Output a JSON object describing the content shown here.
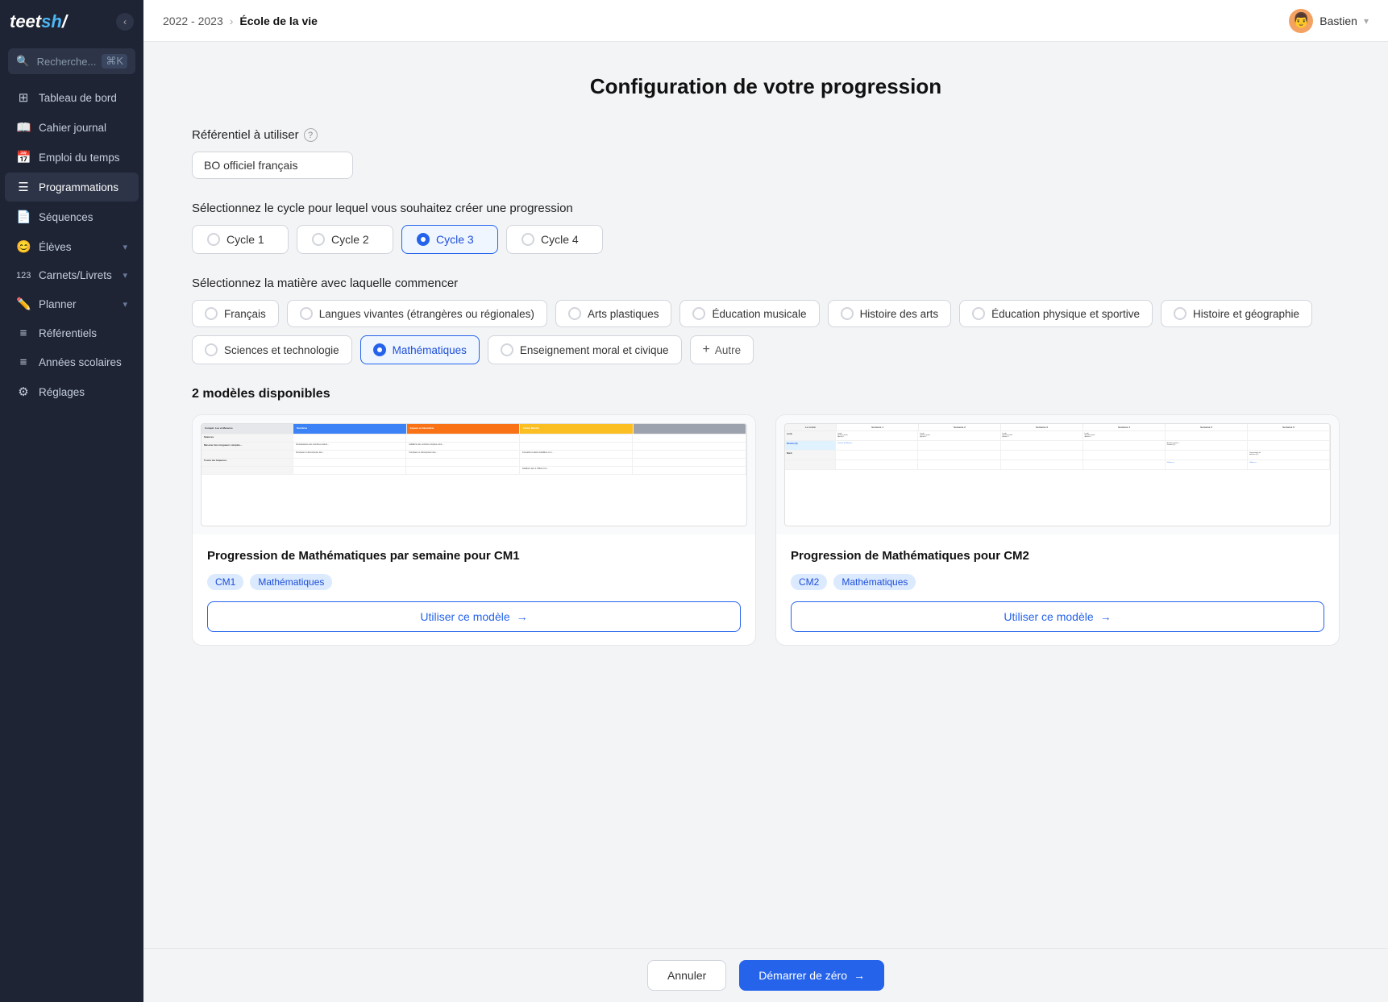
{
  "sidebar": {
    "logo": "teetsh",
    "search": {
      "placeholder": "Recherche...",
      "shortcut": "⌘K"
    },
    "items": [
      {
        "id": "tableau",
        "label": "Tableau de bord",
        "icon": "⊞",
        "active": false
      },
      {
        "id": "cahier",
        "label": "Cahier journal",
        "icon": "📖",
        "active": false
      },
      {
        "id": "emploi",
        "label": "Emploi du temps",
        "icon": "📅",
        "active": false
      },
      {
        "id": "programmations",
        "label": "Programmations",
        "icon": "☰",
        "active": true
      },
      {
        "id": "sequences",
        "label": "Séquences",
        "icon": "📄",
        "active": false
      },
      {
        "id": "eleves",
        "label": "Élèves",
        "icon": "😊",
        "active": false,
        "arrow": true
      },
      {
        "id": "carnets",
        "label": "Carnets/Livrets",
        "icon": "123",
        "active": false,
        "arrow": true
      },
      {
        "id": "planner",
        "label": "Planner",
        "icon": "✏️",
        "active": false,
        "arrow": true
      },
      {
        "id": "referentiels",
        "label": "Référentiels",
        "icon": "≡",
        "active": false
      },
      {
        "id": "annees",
        "label": "Années scolaires",
        "icon": "≡",
        "active": false
      },
      {
        "id": "reglages",
        "label": "Réglages",
        "icon": "⚙",
        "active": false
      }
    ]
  },
  "header": {
    "year": "2022 - 2023",
    "school": "École de la vie",
    "user": "Bastien",
    "avatar": "👨"
  },
  "page": {
    "title": "Configuration de votre progression",
    "referentiel": {
      "label": "Référentiel à utiliser",
      "value": "BO officiel français"
    },
    "cycle": {
      "label": "Sélectionnez le cycle pour lequel vous souhaitez créer une progression",
      "options": [
        {
          "id": "cycle1",
          "label": "Cycle 1",
          "selected": false
        },
        {
          "id": "cycle2",
          "label": "Cycle 2",
          "selected": false
        },
        {
          "id": "cycle3",
          "label": "Cycle 3",
          "selected": true
        },
        {
          "id": "cycle4",
          "label": "Cycle 4",
          "selected": false
        }
      ]
    },
    "matiere": {
      "label": "Sélectionnez la matière avec laquelle commencer",
      "options": [
        {
          "id": "francais",
          "label": "Français",
          "selected": false
        },
        {
          "id": "langues",
          "label": "Langues vivantes (étrangères ou régionales)",
          "selected": false
        },
        {
          "id": "arts",
          "label": "Arts plastiques",
          "selected": false
        },
        {
          "id": "musicale",
          "label": "Éducation musicale",
          "selected": false
        },
        {
          "id": "histoire_arts",
          "label": "Histoire des arts",
          "selected": false
        },
        {
          "id": "eps",
          "label": "Éducation physique et sportive",
          "selected": false
        },
        {
          "id": "histoire_geo",
          "label": "Histoire et géographie",
          "selected": false
        },
        {
          "id": "sciences",
          "label": "Sciences et technologie",
          "selected": false
        },
        {
          "id": "maths",
          "label": "Mathématiques",
          "selected": true
        },
        {
          "id": "emc",
          "label": "Enseignement moral et civique",
          "selected": false
        },
        {
          "id": "autre",
          "label": "Autre",
          "selected": false
        }
      ]
    },
    "models": {
      "count_label": "2 modèles disponibles",
      "items": [
        {
          "id": "model1",
          "title": "Progression de Mathématiques par semaine pour CM1",
          "tags": [
            "CM1",
            "Mathématiques"
          ],
          "button": "Utiliser ce modèle"
        },
        {
          "id": "model2",
          "title": "Progression de Mathématiques pour CM2",
          "tags": [
            "CM2",
            "Mathématiques"
          ],
          "button": "Utiliser ce modèle"
        }
      ]
    }
  },
  "footer": {
    "cancel": "Annuler",
    "start": "Démarrer de zéro"
  }
}
